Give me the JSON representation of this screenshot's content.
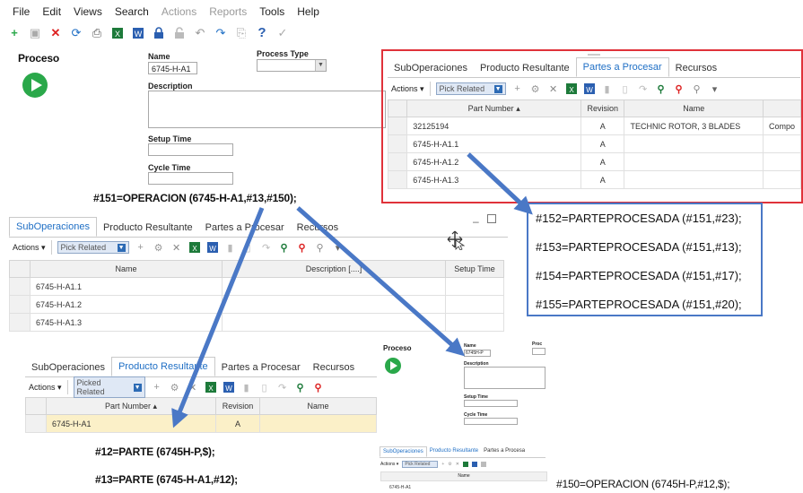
{
  "menu": [
    "File",
    "Edit",
    "Views",
    "Search",
    "Actions",
    "Reports",
    "Tools",
    "Help"
  ],
  "menu_disabled": [
    "Actions",
    "Reports"
  ],
  "toolbar_icons": [
    "new-icon",
    "save-icon",
    "delete-icon",
    "refresh-icon",
    "print-icon",
    "excel-icon",
    "word-icon",
    "lock-icon",
    "unlock-icon",
    "undo-icon",
    "redo-icon",
    "copy-icon",
    "help-icon",
    "check-icon"
  ],
  "main_form": {
    "title": "Proceso",
    "name_label": "Name",
    "name_value": "6745-H-A1",
    "process_type_label": "Process Type",
    "description_label": "Description",
    "setup_time_label": "Setup Time",
    "cycle_time_label": "Cycle Time"
  },
  "red_panel": {
    "tabs": [
      "SubOperaciones",
      "Producto Resultante",
      "Partes a Procesar",
      "Recursos"
    ],
    "active_tab": 2,
    "actions_label": "Actions",
    "pick_related": "Pick Related",
    "columns": [
      "Part Number",
      "Revision",
      "Name"
    ],
    "rows": [
      [
        "32125194",
        "A",
        "TECHNIC ROTOR, 3 BLADES",
        "Compo"
      ],
      [
        "6745-H-A1.1",
        "A",
        "",
        ""
      ],
      [
        "6745-H-A1.2",
        "A",
        "",
        ""
      ],
      [
        "6745-H-A1.3",
        "A",
        "",
        ""
      ]
    ]
  },
  "step_151": "#151=OPERACION (6745-H-A1,#13,#150);",
  "processed_parts": [
    "#152=PARTEPROCESADA (#151,#23);",
    "#153=PARTEPROCESADA (#151,#13);",
    "#154=PARTEPROCESADA (#151,#17);",
    "#155=PARTEPROCESADA (#151,#20);"
  ],
  "sub_panel": {
    "tabs": [
      "SubOperaciones",
      "Producto Resultante",
      "Partes a Procesar",
      "Recursos"
    ],
    "active_tab": 0,
    "actions_label": "Actions",
    "pick_related": "Pick Related",
    "columns": [
      "Name",
      "Description [....]",
      "Setup Time"
    ],
    "rows": [
      "6745-H-A1.1",
      "6745-H-A1.2",
      "6745-H-A1.3"
    ]
  },
  "result_panel": {
    "tabs": [
      "SubOperaciones",
      "Producto Resultante",
      "Partes a Procesar",
      "Recursos"
    ],
    "active_tab": 1,
    "actions_label": "Actions",
    "pick_related": "Picked Related",
    "columns": [
      "Part Number",
      "Revision",
      "Name"
    ],
    "rows": [
      [
        "6745-H-A1",
        "A",
        ""
      ]
    ]
  },
  "step_12": "#12=PARTE (6745H-P,$);",
  "step_13": "#13=PARTE (6745-H-A1,#12);",
  "mini_form": {
    "title": "Proceso",
    "name_label": "Name",
    "name_value": "6745H-P",
    "process_label": "Proc",
    "description_label": "Description",
    "setup_time_label": "Setup Time",
    "cycle_time_label": "Cycle Time",
    "tabs": [
      "SubOperaciones",
      "Producto Resultante",
      "Partes a Procesa"
    ],
    "actions_label": "Actions",
    "pick_related": "Pick Related",
    "column": "Name",
    "row": "6745-H-A1"
  },
  "step_150": "#150=OPERACION (6745H-P,#12,$);",
  "colors": {
    "accent": "#1f6fc5",
    "arrow": "#4a78c6",
    "red_box": "#e0323a",
    "play": "#2aa84a",
    "selected_row": "#fbf0c8"
  }
}
